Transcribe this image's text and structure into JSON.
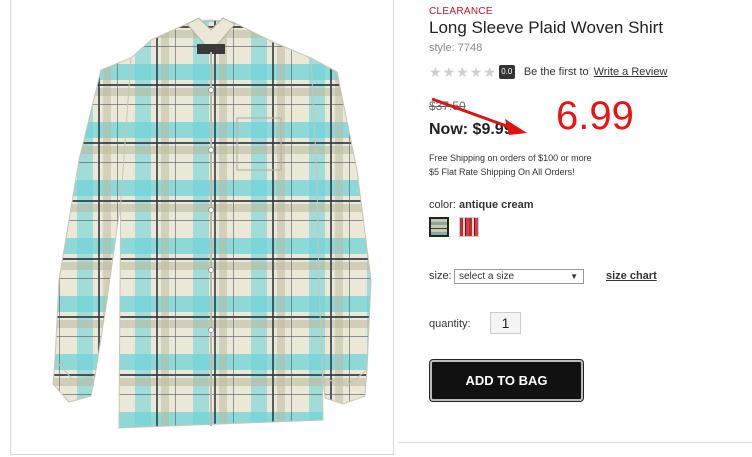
{
  "product": {
    "badge": "CLEARANCE",
    "title": "Long Sleeve Plaid Woven Shirt",
    "style": "style: 7748",
    "rating_score": "0.0",
    "rating_prompt": "Be the first to",
    "review_link": "Write a Review",
    "was_price": "$37.50",
    "now_price": "Now: $9.99",
    "shipping_line_1": "Free Shipping on orders of $100 or more",
    "shipping_line_2": "$5 Flat Rate Shipping On All Orders!",
    "color_label": "color:",
    "color_value": "antique cream",
    "size_label": "size:",
    "size_selected": "select a size",
    "size_chart": "size chart",
    "quantity_label": "quantity:",
    "quantity_value": "1",
    "add_to_bag": "ADD TO BAG"
  },
  "annotation": {
    "price_note": "6.99",
    "color": "#e11111"
  },
  "colors": {
    "clearance_red": "#c8102e",
    "button_bg": "#111111",
    "shirt_teal": "#5fd0d6",
    "shirt_cream": "#ece8d8"
  }
}
